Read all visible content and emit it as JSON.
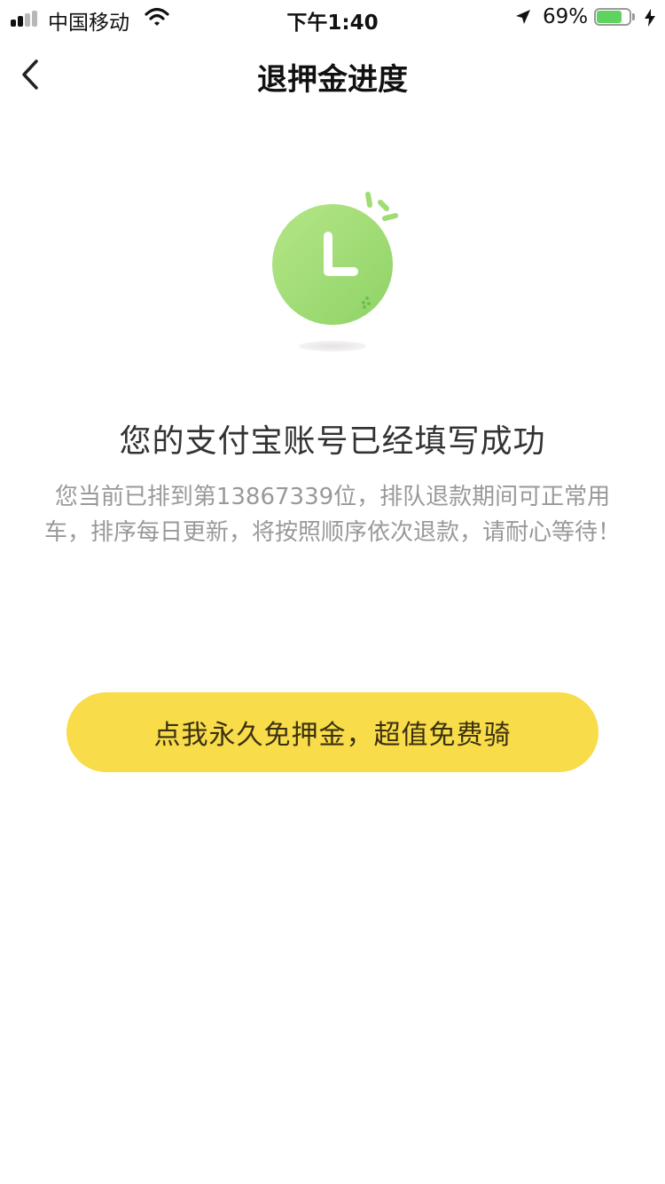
{
  "status_bar": {
    "carrier": "中国移动",
    "time": "下午1:40",
    "battery_percent": "69%",
    "battery_level": 0.69,
    "signal_bars_active": 2,
    "signal_bars_total": 4,
    "icons": [
      "signal-icon",
      "wifi-icon",
      "location-arrow-icon",
      "battery-icon",
      "charging-bolt-icon"
    ]
  },
  "nav": {
    "title": "退押金进度",
    "back_icon": "chevron-left-icon"
  },
  "illustration": {
    "icon": "clock-icon",
    "color": "#9fdc74"
  },
  "message": {
    "headline": "您的支付宝账号已经填写成功",
    "description": "您当前已排到第13867339位，排队退款期间可正常用车，排序每日更新，将按照顺序依次退款，请耐心等待！"
  },
  "cta": {
    "label": "点我永久免押金，超值免费骑",
    "color": "#f8dc4a"
  }
}
